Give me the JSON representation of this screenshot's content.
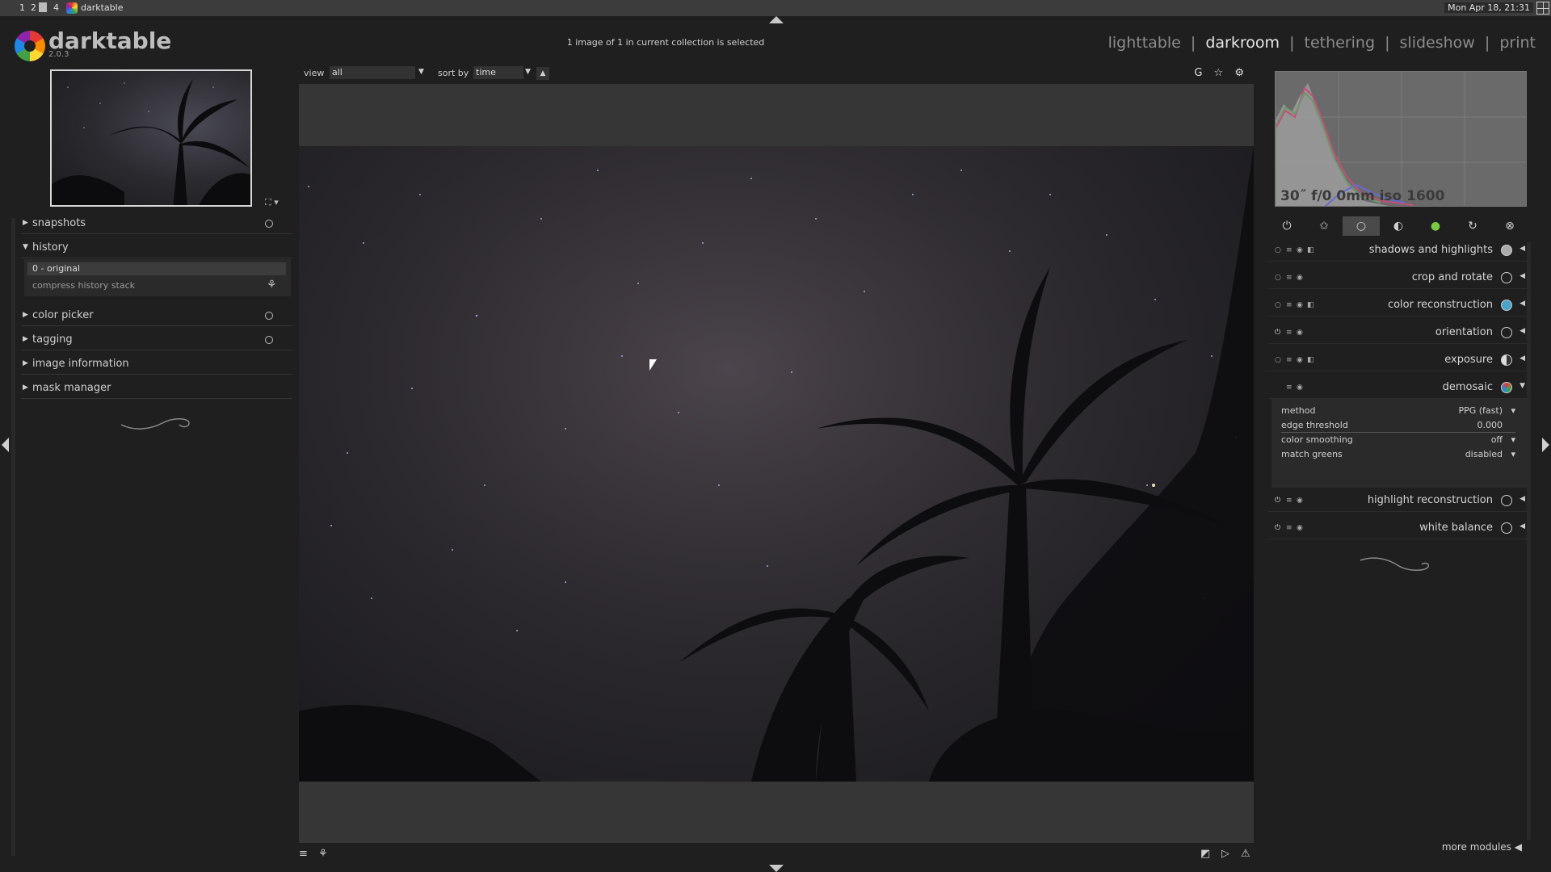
{
  "taskbar": {
    "workspaces": [
      "1",
      "2",
      "4"
    ],
    "window_title": "darktable",
    "clock": "Mon Apr 18, 21:31"
  },
  "header": {
    "brand": "darktable",
    "version": "2.0.3",
    "collection_info": "1 image of 1 in current collection is selected",
    "views": [
      {
        "label": "lighttable",
        "active": false
      },
      {
        "label": "darkroom",
        "active": true
      },
      {
        "label": "tethering",
        "active": false
      },
      {
        "label": "slideshow",
        "active": false
      },
      {
        "label": "print",
        "active": false
      }
    ],
    "separator": "|"
  },
  "filter_bar": {
    "view_label": "view",
    "view_value": "all",
    "sort_label": "sort by",
    "sort_value": "time",
    "icons": [
      "G",
      "☆",
      "⚙"
    ]
  },
  "left_panel": {
    "modules": [
      {
        "label": "snapshots",
        "expanded": false,
        "has_reset": true
      },
      {
        "label": "history",
        "expanded": true,
        "has_reset": false
      },
      {
        "label": "color picker",
        "expanded": false,
        "has_reset": true
      },
      {
        "label": "tagging",
        "expanded": false,
        "has_reset": true
      },
      {
        "label": "image information",
        "expanded": false,
        "has_reset": false
      },
      {
        "label": "mask manager",
        "expanded": false,
        "has_reset": false
      }
    ],
    "history_items": [
      "0 - original"
    ],
    "compress_label": "compress history stack"
  },
  "right_panel": {
    "histogram_info": "30˝ f/0 0mm iso 1600",
    "modules": [
      {
        "name": "shadows and highlights",
        "enabled": false
      },
      {
        "name": "crop and rotate",
        "enabled": false
      },
      {
        "name": "color reconstruction",
        "enabled": false
      },
      {
        "name": "orientation",
        "enabled": true
      },
      {
        "name": "exposure",
        "enabled": false
      },
      {
        "name": "demosaic",
        "enabled": true,
        "expanded": true
      },
      {
        "name": "highlight reconstruction",
        "enabled": true
      },
      {
        "name": "white balance",
        "enabled": true
      }
    ],
    "demosaic_params": [
      {
        "label": "method",
        "value": "PPG (fast)"
      },
      {
        "label": "edge threshold",
        "value": "0.000"
      },
      {
        "label": "color smoothing",
        "value": "off"
      },
      {
        "label": "match greens",
        "value": "disabled"
      }
    ],
    "more_modules": "more modules"
  },
  "colors": {
    "background": "#1f1f1f",
    "canvas": "#363636",
    "active_view": "#e6e6e6",
    "inactive_view": "#8c8c8c"
  }
}
